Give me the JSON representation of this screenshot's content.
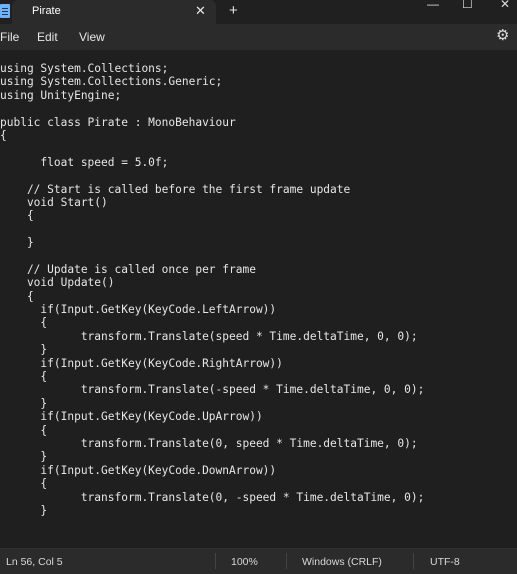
{
  "window": {
    "tab_title": "Pirate",
    "tab_close": "✕",
    "new_tab": "+",
    "minimize": "—",
    "maximize": "☐",
    "close": "✕"
  },
  "menu": {
    "items": [
      "File",
      "Edit",
      "View"
    ],
    "settings_icon": "⚙"
  },
  "editor": {
    "lines": [
      "using System.Collections;",
      "using System.Collections.Generic;",
      "using UnityEngine;",
      "",
      "public class Pirate : MonoBehaviour",
      "{",
      "",
      "      float speed = 5.0f;",
      "",
      "    // Start is called before the first frame update",
      "    void Start()",
      "    {",
      "",
      "    }",
      "",
      "    // Update is called once per frame",
      "    void Update()",
      "    {",
      "      if(Input.GetKey(KeyCode.LeftArrow))",
      "      {",
      "            transform.Translate(speed * Time.deltaTime, 0, 0);",
      "      }",
      "      if(Input.GetKey(KeyCode.RightArrow))",
      "      {",
      "            transform.Translate(-speed * Time.deltaTime, 0, 0);",
      "      }",
      "      if(Input.GetKey(KeyCode.UpArrow))",
      "      {",
      "            transform.Translate(0, speed * Time.deltaTime, 0);",
      "      }",
      "      if(Input.GetKey(KeyCode.DownArrow))",
      "      {",
      "            transform.Translate(0, -speed * Time.deltaTime, 0);",
      "      }"
    ]
  },
  "status": {
    "position": "Ln 56, Col 5",
    "zoom": "100%",
    "line_ending": "Windows (CRLF)",
    "encoding": "UTF-8"
  }
}
